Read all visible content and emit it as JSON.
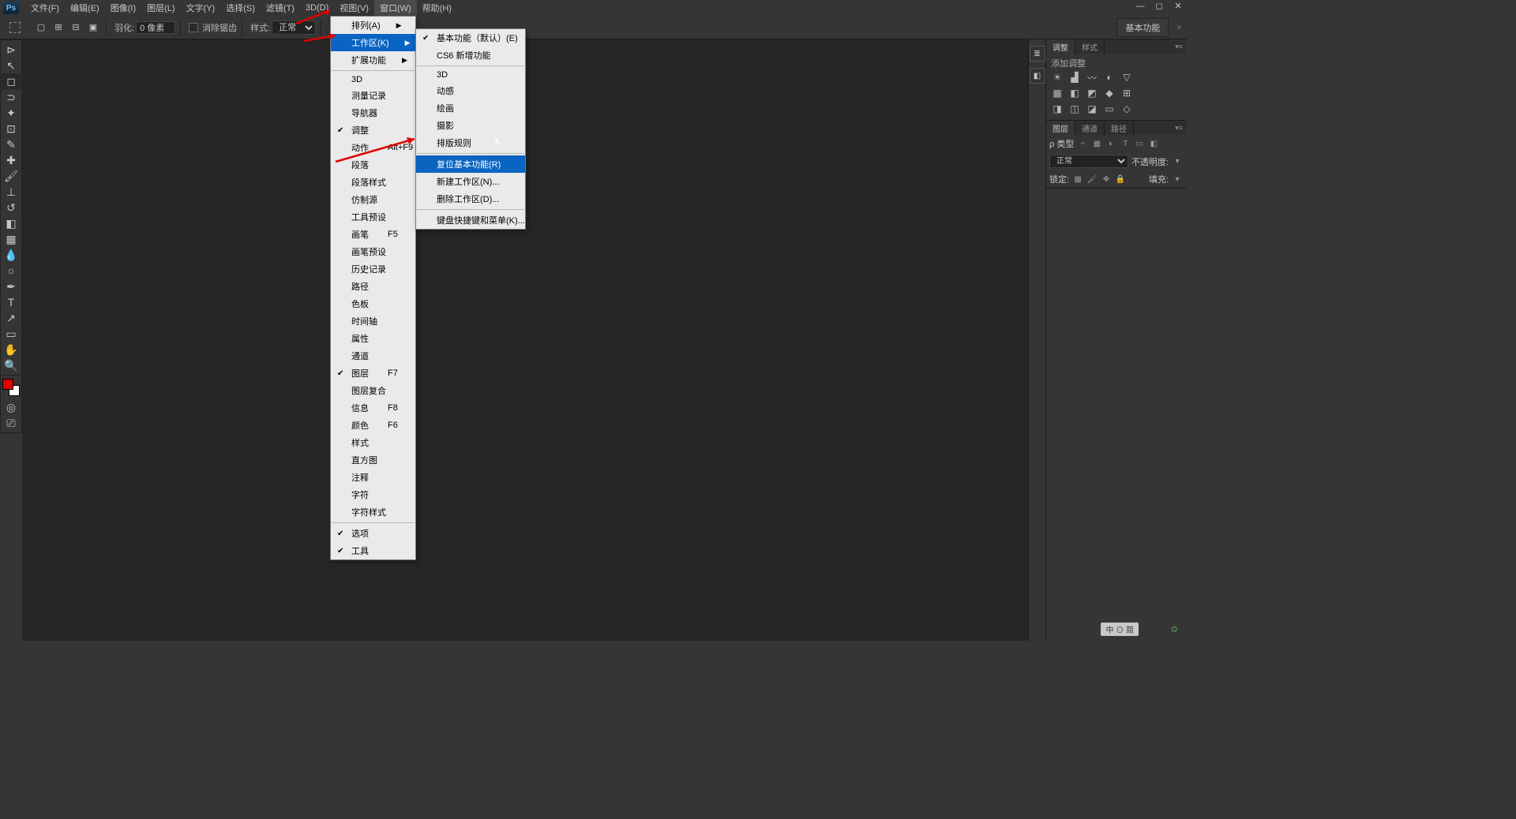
{
  "menubar": {
    "items": [
      "文件(F)",
      "编辑(E)",
      "图像(I)",
      "图层(L)",
      "文字(Y)",
      "选择(S)",
      "滤镜(T)",
      "3D(D)",
      "视图(V)",
      "窗口(W)",
      "帮助(H)"
    ],
    "active_index": 9
  },
  "options": {
    "feather_label": "羽化:",
    "feather_value": "0 像素",
    "antialias_label": "消除锯齿",
    "style_label": "样式:",
    "style_value": "正常"
  },
  "workspace_btn": "基本功能",
  "window_menu": {
    "items": [
      {
        "label": "排列(A)",
        "submenu": true
      },
      {
        "label": "工作区(K)",
        "submenu": true,
        "highlight": true
      },
      {
        "label": "扩展功能",
        "submenu": true
      },
      {
        "sep": true
      },
      {
        "label": "3D"
      },
      {
        "label": "测量记录"
      },
      {
        "label": "导航器"
      },
      {
        "label": "调整",
        "checked": true
      },
      {
        "label": "动作",
        "shortcut": "Alt+F9"
      },
      {
        "label": "段落"
      },
      {
        "label": "段落样式"
      },
      {
        "label": "仿制源"
      },
      {
        "label": "工具预设"
      },
      {
        "label": "画笔",
        "shortcut": "F5"
      },
      {
        "label": "画笔预设"
      },
      {
        "label": "历史记录"
      },
      {
        "label": "路径"
      },
      {
        "label": "色板"
      },
      {
        "label": "时间轴"
      },
      {
        "label": "属性"
      },
      {
        "label": "通道"
      },
      {
        "label": "图层",
        "shortcut": "F7",
        "checked": true
      },
      {
        "label": "图层复合"
      },
      {
        "label": "信息",
        "shortcut": "F8"
      },
      {
        "label": "颜色",
        "shortcut": "F6"
      },
      {
        "label": "样式"
      },
      {
        "label": "直方图"
      },
      {
        "label": "注释"
      },
      {
        "label": "字符"
      },
      {
        "label": "字符样式"
      },
      {
        "sep": true
      },
      {
        "label": "选项",
        "checked": true
      },
      {
        "label": "工具",
        "checked": true
      }
    ]
  },
  "workspace_submenu": {
    "items": [
      {
        "label": "基本功能（默认）(E)",
        "checked": true
      },
      {
        "label": "CS6 新增功能"
      },
      {
        "sep": true
      },
      {
        "label": "3D"
      },
      {
        "label": "动感"
      },
      {
        "label": "绘画"
      },
      {
        "label": "摄影"
      },
      {
        "label": "排版规则"
      },
      {
        "sep": true
      },
      {
        "label": "复位基本功能(R)",
        "highlight": true
      },
      {
        "label": "新建工作区(N)..."
      },
      {
        "label": "删除工作区(D)..."
      },
      {
        "sep": true
      },
      {
        "label": "键盘快捷键和菜单(K)..."
      }
    ]
  },
  "panels": {
    "adjustments_tab": "调整",
    "styles_tab": "样式",
    "add_adjustment": "添加调整",
    "layers_tab": "图层",
    "channels_tab": "通道",
    "paths_tab": "路径",
    "kind_label": "ρ 类型",
    "blend_mode": "正常",
    "opacity_label": "不透明度:",
    "lock_label": "锁定:",
    "fill_label": "填充:"
  },
  "logo": "Ps"
}
